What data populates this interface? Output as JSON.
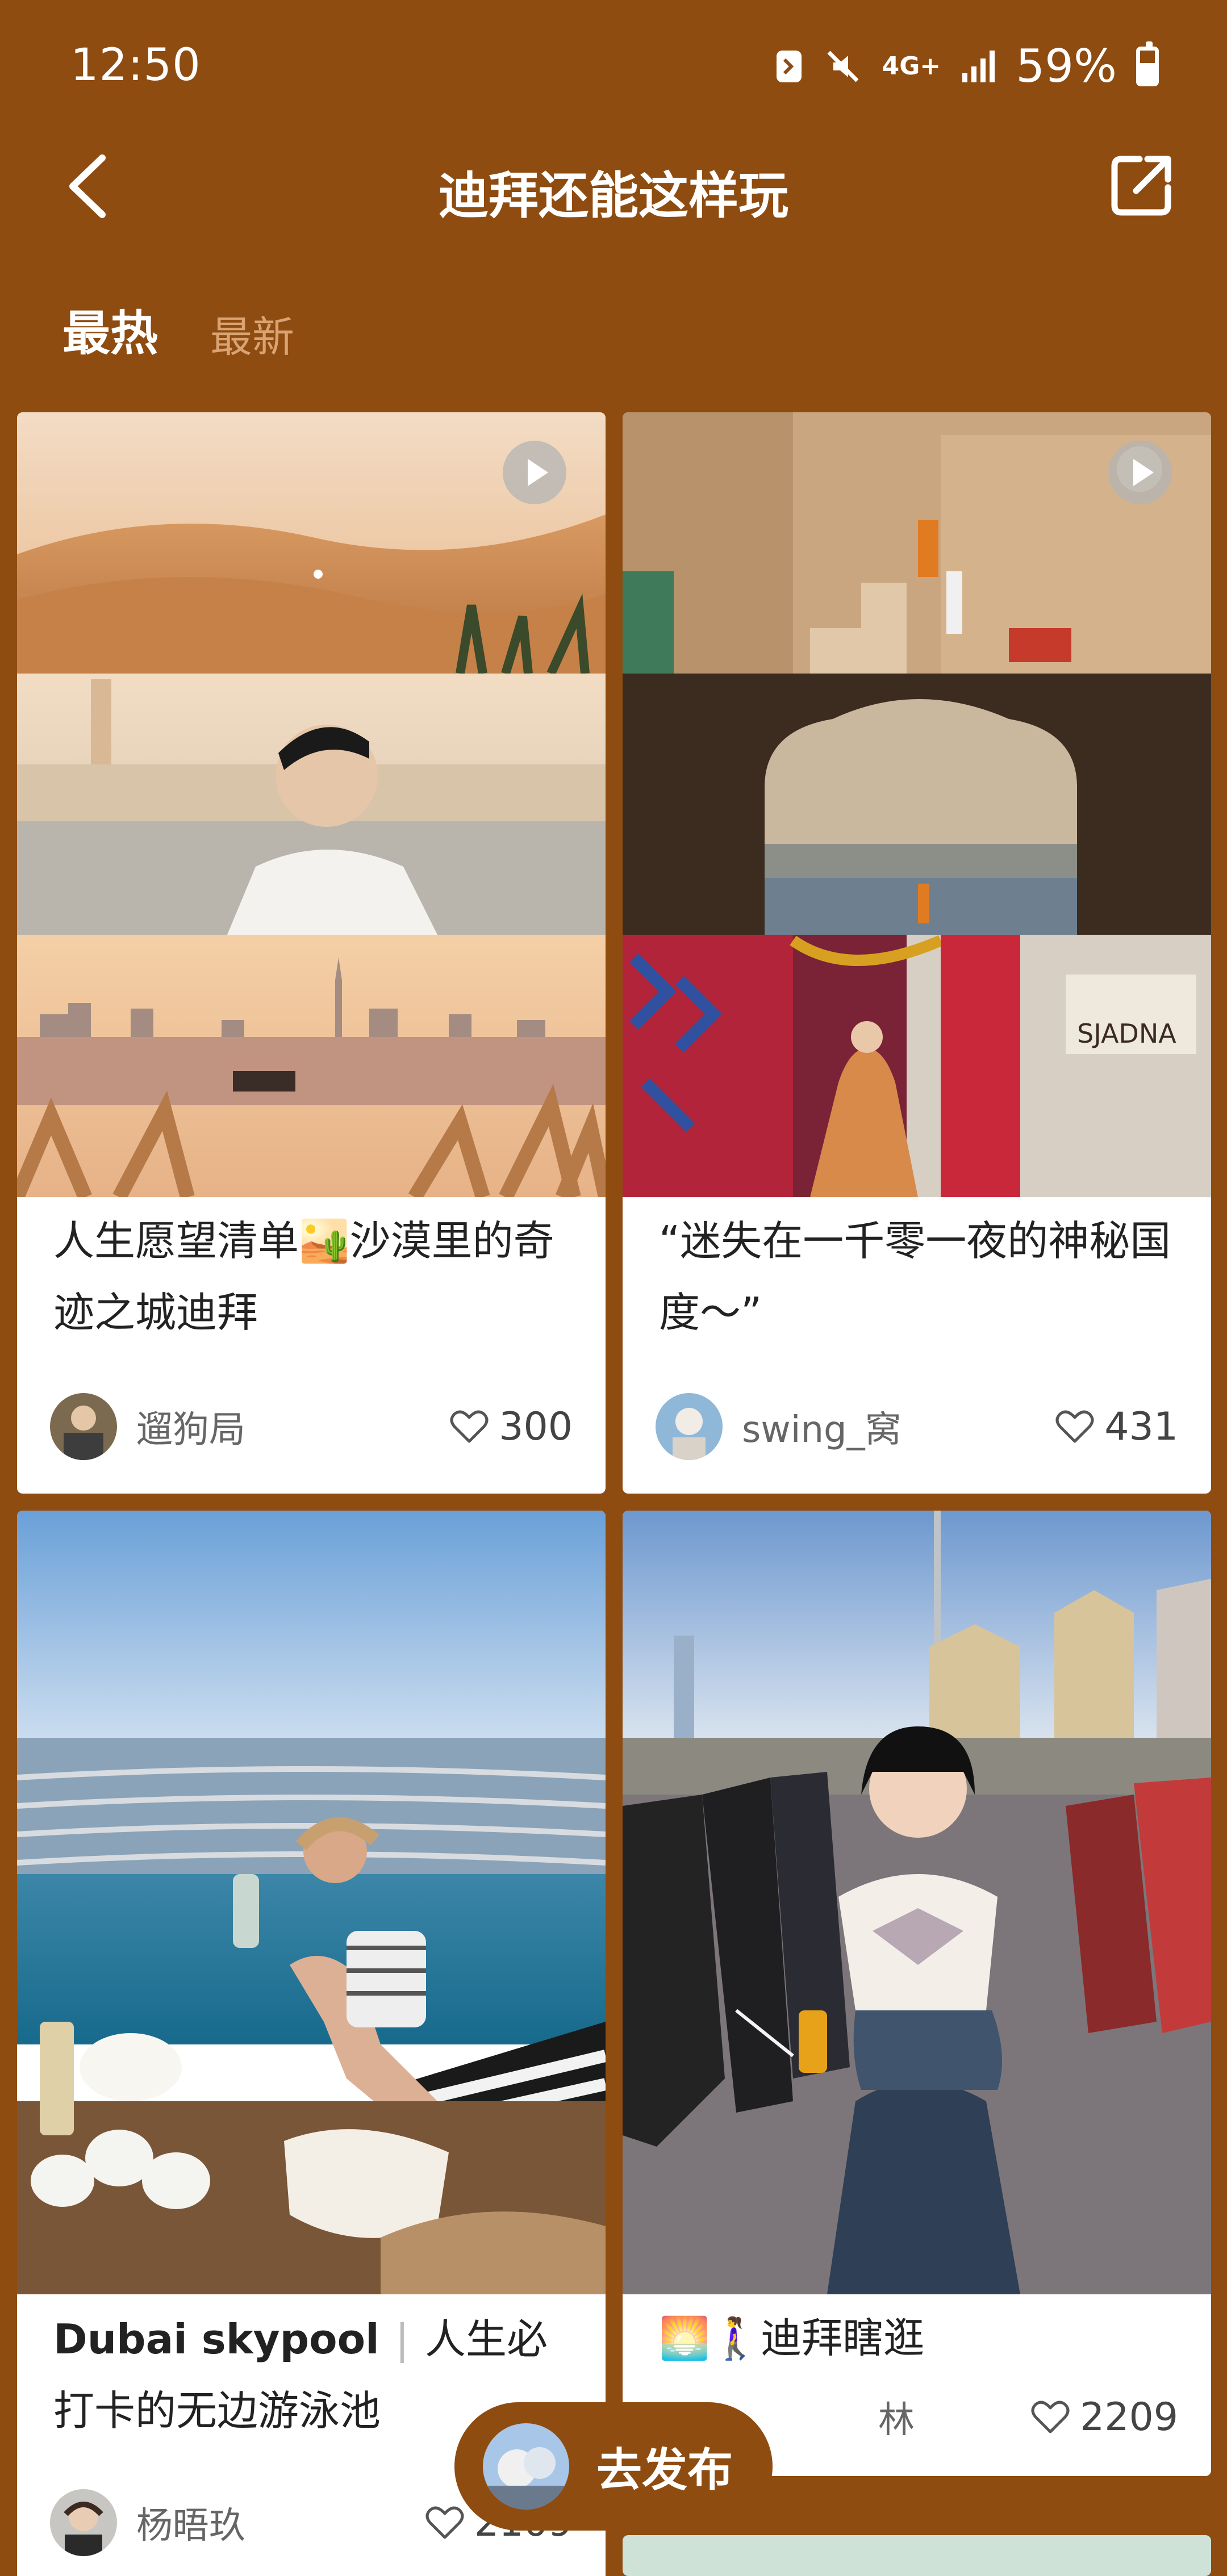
{
  "status_bar": {
    "time": "12:50",
    "battery_percent": "59%",
    "network": "4G+",
    "icons": [
      "nfc-icon",
      "mute-icon",
      "network-4g-icon",
      "signal-icon",
      "battery-icon"
    ]
  },
  "header": {
    "title": "迪拜还能这样玩",
    "back_icon": "chevron-left-icon",
    "share_icon": "share-external-icon"
  },
  "tabs": [
    {
      "label": "最热",
      "active": true
    },
    {
      "label": "最新",
      "active": false
    }
  ],
  "posts": [
    {
      "title": "人生愿望清单🏜️沙漠里的奇迹之城迪拜",
      "author": "遛狗局",
      "likes": "300",
      "is_video": true
    },
    {
      "title": "“迷失在一千零一夜的神秘国度～”",
      "author": "swing_窝",
      "likes": "431",
      "is_video": true
    },
    {
      "title_en": "Dubai skypool",
      "title_rest": "人生必打卡的无边游泳池",
      "author": "杨晤玖",
      "likes": "2109",
      "is_video": false
    },
    {
      "title": "迪拜瞎逛",
      "title_emoji": "🌅🚶‍♀️",
      "author": "林",
      "likes": "2209",
      "is_video": false
    }
  ],
  "publish": {
    "label": "去发布"
  },
  "colors": {
    "background": "#8f4c10",
    "card": "#ffffff",
    "inactive_tab": "#d9a373"
  }
}
